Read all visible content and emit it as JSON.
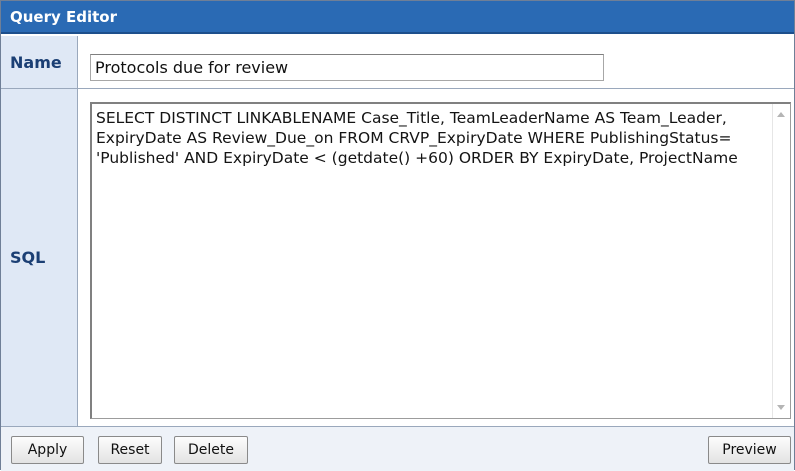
{
  "window": {
    "title": "Query Editor"
  },
  "form": {
    "name_label": "Name",
    "name_value": "Protocols due for review",
    "sql_label": "SQL",
    "sql_value": "SELECT DISTINCT LINKABLENAME Case_Title, TeamLeaderName AS Team_Leader, ExpiryDate AS Review_Due_on FROM CRVP_ExpiryDate WHERE PublishingStatus= 'Published' AND ExpiryDate < (getdate() +60) ORDER BY ExpiryDate, ProjectName"
  },
  "actions": {
    "apply": "Apply",
    "reset": "Reset",
    "delete": "Delete",
    "preview": "Preview"
  },
  "icons": {
    "scroll_up": "scroll-up-arrow-icon",
    "scroll_down": "scroll-down-arrow-icon"
  },
  "colors": {
    "title_bar": "#2a6ab4",
    "label_bg": "#dfe8f5",
    "label_text": "#1b3f74"
  }
}
